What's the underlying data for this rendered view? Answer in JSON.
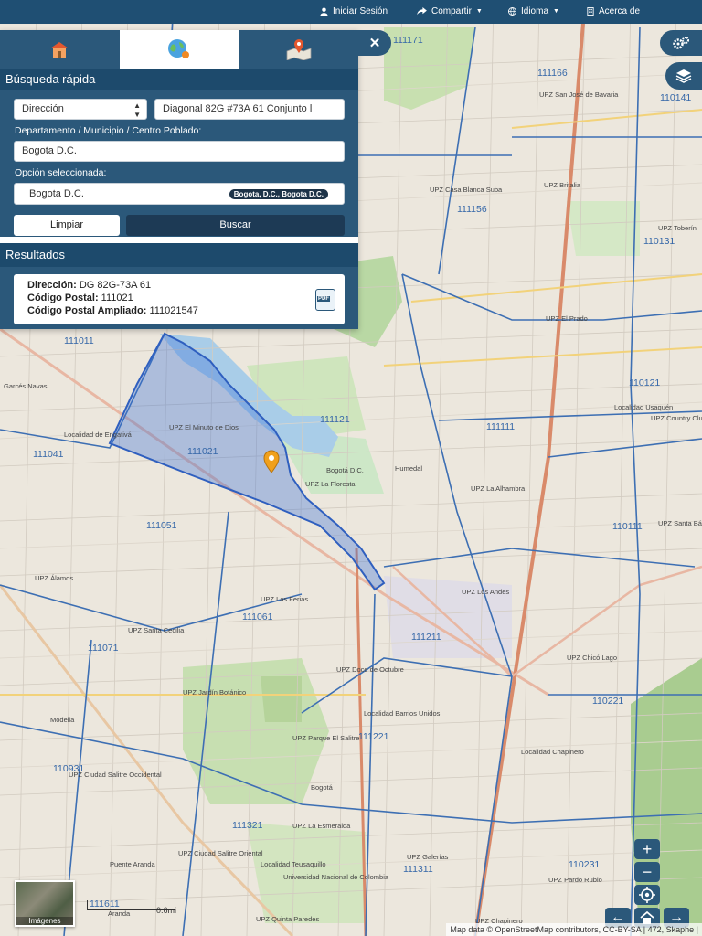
{
  "topbar": {
    "login_label": "Iniciar Sesión",
    "share_label": "Compartir",
    "language_label": "Idioma",
    "about_label": "Acerca de"
  },
  "panel": {
    "quick_search_title": "Búsqueda rápida",
    "search_type_value": "Dirección",
    "address_value": "Diagonal 82G #73A 61 Conjunto l",
    "location_label": "Departamento / Municipio / Centro Poblado:",
    "location_value": "Bogota D.C.",
    "selected_option_label": "Opción seleccionada:",
    "selected_option_value": "Bogota D.C.",
    "selected_option_badge": "Bogota, D.C., Bogota D.C.",
    "clear_label": "Limpiar",
    "search_label": "Buscar",
    "results_title": "Resultados",
    "result": {
      "address_key": "Dirección:",
      "address_val": "DG 82G-73A 61",
      "postal_key": "Código Postal:",
      "postal_val": "111021",
      "extended_key": "Código Postal Ampliado:",
      "extended_val": "111021547",
      "pdf_label": "PDF"
    }
  },
  "map": {
    "zone_labels": [
      {
        "text": "111171"
      },
      {
        "text": "111166"
      },
      {
        "text": "110141"
      },
      {
        "text": "111156"
      },
      {
        "text": "110131"
      },
      {
        "text": "111011"
      },
      {
        "text": "111121"
      },
      {
        "text": "111111"
      },
      {
        "text": "110121"
      },
      {
        "text": "111021"
      },
      {
        "text": "111041"
      },
      {
        "text": "111051"
      },
      {
        "text": "110111"
      },
      {
        "text": "111061"
      },
      {
        "text": "111211"
      },
      {
        "text": "111071"
      },
      {
        "text": "110221"
      },
      {
        "text": "111221"
      },
      {
        "text": "110931"
      },
      {
        "text": "111321"
      },
      {
        "text": "111311"
      },
      {
        "text": "110231"
      },
      {
        "text": "111611"
      }
    ],
    "place_labels": [
      {
        "text": "UPZ El Prado"
      },
      {
        "text": "Localidad Usaquén"
      },
      {
        "text": "UPZ Country Club"
      },
      {
        "text": "Localidad de Engativá"
      },
      {
        "text": "UPZ El Minuto de Dios"
      },
      {
        "text": "UPZ La Floresta"
      },
      {
        "text": "UPZ La Alhambra"
      },
      {
        "text": "UPZ Santa Bárbara"
      },
      {
        "text": "UPZ Las Ferias"
      },
      {
        "text": "UPZ Los Andes"
      },
      {
        "text": "UPZ Álamos"
      },
      {
        "text": "UPZ Santa Cecilia"
      },
      {
        "text": "UPZ Chicó Lago"
      },
      {
        "text": "UPZ Doce de Octubre"
      },
      {
        "text": "Localidad Barrios Unidos"
      },
      {
        "text": "UPZ Jardín Botánico"
      },
      {
        "text": "UPZ Parque El Salitre"
      },
      {
        "text": "Localidad Chapinero"
      },
      {
        "text": "UPZ Ciudad Salitre Occidental"
      },
      {
        "text": "Bogotá"
      },
      {
        "text": "UPZ La Esmeralda"
      },
      {
        "text": "UPZ Ciudad Salitre Oriental"
      },
      {
        "text": "Localidad Teusaquillo"
      },
      {
        "text": "Universidad Nacional de Colombia"
      },
      {
        "text": "UPZ Galerías"
      },
      {
        "text": "UPZ Pardo Rubio"
      },
      {
        "text": "UPZ Chapinero"
      },
      {
        "text": "UPZ Britalia"
      },
      {
        "text": "UPZ Casa Blanca Suba"
      },
      {
        "text": "UPZ San José de Bavaria"
      },
      {
        "text": "UPZ Toberín"
      },
      {
        "text": "Humedal"
      },
      {
        "text": "Bogotá D.C."
      },
      {
        "text": "Modelia"
      },
      {
        "text": "Puente Aranda"
      },
      {
        "text": "Aranda"
      },
      {
        "text": "UPZ Quinta Paredes"
      },
      {
        "text": "Garcés Navas"
      }
    ],
    "scale_label": "0.6mi",
    "imagery_label": "Imágenes",
    "attribution": "Map data © OpenStreetMap contributors, CC-BY-SA | 472, Skaphe |",
    "accent_color": "#2b587a",
    "polygon_color": "#3a6fd8",
    "marker_color": "#f0a01c"
  }
}
